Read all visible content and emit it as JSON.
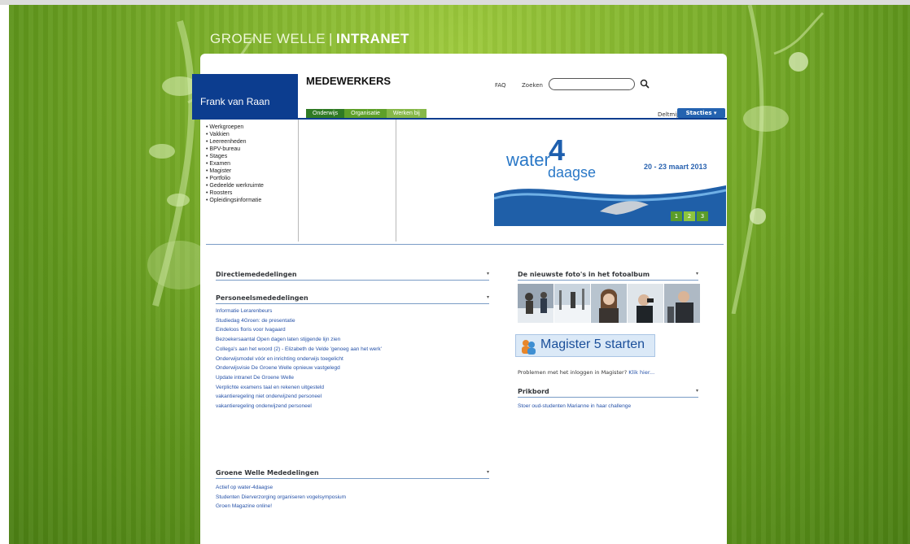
{
  "site": {
    "title_left": "GROENE WELLE",
    "separator": "|",
    "title_right": "INTRANET"
  },
  "header": {
    "user_name": "Frank van Raan",
    "section_title": "MEDEWERKERS",
    "faq": "FAQ",
    "search_label": "Zoeken",
    "search_value": "",
    "deltmijn": "Deltmijn",
    "stacties": "Stacties ▾",
    "tabs": [
      {
        "label": "Onderwijs"
      },
      {
        "label": "Organisatie"
      },
      {
        "label": "Werken bij"
      }
    ]
  },
  "menu": [
    "• Werkgroepen",
    "• Vakkien",
    "• Leereenheden",
    "• BPV-bureau",
    "• Stages",
    "• Examen",
    "• Magister",
    "• Portfolio",
    "• Gedeelde werkruimte",
    "• Roosters",
    "• Opleidingsinformatie"
  ],
  "banner": {
    "water": "water",
    "four": "4",
    "daagse": "daagse",
    "dates": "20 - 23 maart 2013",
    "pages": [
      "1",
      "2",
      "3"
    ],
    "active_page": 2
  },
  "left": {
    "directie": {
      "title": "Directiemededelingen",
      "arrow": "▾"
    },
    "personeel": {
      "title": "Personeelsmededelingen",
      "arrow": "▾",
      "items": [
        "Informatie Lerarenbeurs",
        "Studiedag 4Groen: de presentatie",
        "Eindeloos floris voor Ivagaard",
        "Bezoekersaantal Open dagen laten stijgende lijn zien",
        "Collega's aan het woord (2) - Elizabeth de Velde 'genoeg aan het werk'",
        "Onderwijsmodel vóór en inrichting onderwijs toegelicht",
        "Onderwijsvisie De Groene Welle opnieuw vastgelegd",
        "Update intranet De Groene Welle",
        "Verplichte examens taal en rekenen uitgesteld",
        "vakantieregeling niet onderwijzend personeel",
        "vakantieregeling onderwijzend personeel"
      ]
    },
    "groene": {
      "title": "Groene Welle Mededelingen",
      "arrow": "▾",
      "items": [
        "Actief op water-4daagse",
        "Studenten Dierverzorging organiseren vogelsymposium",
        "Groen Magazine online!"
      ]
    }
  },
  "right": {
    "photos": {
      "title": "De nieuwste foto's in het fotoalbum",
      "arrow": "▾"
    },
    "magister": {
      "label": "Magister 5 starten"
    },
    "problems": {
      "text": "Problemen met het inloggen in Magister?",
      "link": "Klik hier..."
    },
    "prikbord": {
      "title": "Prikbord",
      "arrow": "▾",
      "items": [
        "Stoer oud-studenten Marianne in haar challenge"
      ]
    }
  },
  "colors": {
    "brand_blue": "#0c3d8f",
    "green": "#7fb22c",
    "link": "#2652a8"
  }
}
